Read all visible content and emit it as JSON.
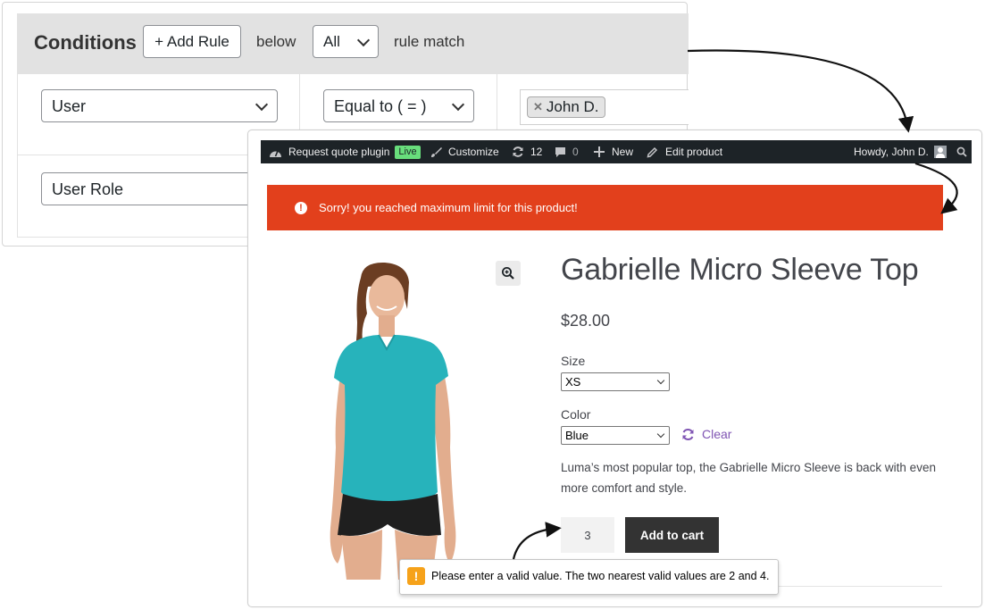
{
  "conditions": {
    "title": "Conditions",
    "add_rule_label": "+ Add Rule",
    "below_label": "below",
    "match_select": "All",
    "rule_match_label": "rule match",
    "row1": {
      "field": "User",
      "operator": "Equal to ( = )",
      "tag": "John D."
    },
    "row2": {
      "field": "User Role"
    }
  },
  "adminbar": {
    "site": "Request quote plugin",
    "live_badge": "Live",
    "customize": "Customize",
    "updates_count": "12",
    "comments_count": "0",
    "new_label": "New",
    "edit_product": "Edit product",
    "howdy": "Howdy, John D."
  },
  "notice": {
    "error_text": "Sorry! you reached maximum limit for this product!",
    "error_color": "#e2401c"
  },
  "product": {
    "title": "Gabrielle Micro Sleeve Top",
    "price": "$28.00",
    "size_label": "Size",
    "size_value": "XS",
    "color_label": "Color",
    "color_value": "Blue",
    "clear_label": "Clear",
    "description": "Luma’s most popular top, the Gabrielle Micro Sleeve is back with even more comfort and style.",
    "quantity": "3",
    "add_to_cart_label": "Add to cart"
  },
  "validation_tooltip": {
    "text": "Please enter a valid value. The two nearest valid values are 2 and 4."
  }
}
